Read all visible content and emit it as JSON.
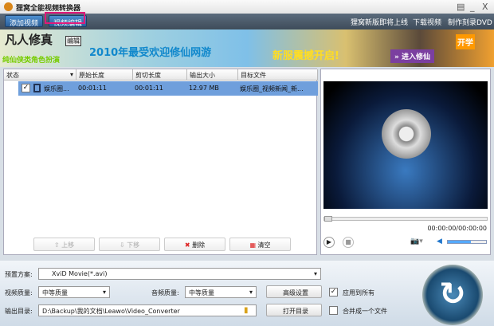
{
  "window": {
    "title": "狸窝全能视频转换器",
    "menu_icon": "menu-icon",
    "minimize": "_",
    "close": "X"
  },
  "toolbar": {
    "add_video": "添加视频",
    "edit_video": "视频编辑",
    "links": [
      "狸窝新版即将上线",
      "下载视频",
      "制作刻录DVD"
    ]
  },
  "banner": {
    "game": "凡人修真",
    "edit": "编辑",
    "subtitle": "纯仙侠类角色扮演",
    "headline": "2010年最受欢迎修仙网游",
    "slogan": "新服震撼开启!",
    "enter": "» 进入修仙",
    "side": "开学"
  },
  "list": {
    "columns": [
      "状态",
      "原始长度",
      "剪切长度",
      "输出大小",
      "目标文件"
    ],
    "rows": [
      {
        "checked": true,
        "name": "娱乐圈...",
        "orig": "00:01:11",
        "cut": "00:01:11",
        "size": "12.97 MB",
        "target": "娱乐圈_视频新闻_新..."
      }
    ],
    "buttons": {
      "up": "上移",
      "down": "下移",
      "delete": "删除",
      "clear": "清空"
    }
  },
  "preview": {
    "time": "00:00:00/00:00:00",
    "progress": 0,
    "volume": 0.6
  },
  "settings": {
    "preset_label": "预置方案:",
    "preset": "XviD Movie(*.avi)",
    "video_quality_label": "视频质量:",
    "video_quality": "中等质量",
    "audio_quality_label": "音频质量:",
    "audio_quality": "中等质量",
    "advanced": "高级设置",
    "apply_all": "应用到所有",
    "apply_all_checked": true,
    "output_label": "输出目录:",
    "output_dir": "D:\\Backup\\我的文档\\Leawo\\Video_Converter",
    "open_dir": "打开目录",
    "merge": "合并成一个文件",
    "merge_checked": false
  }
}
